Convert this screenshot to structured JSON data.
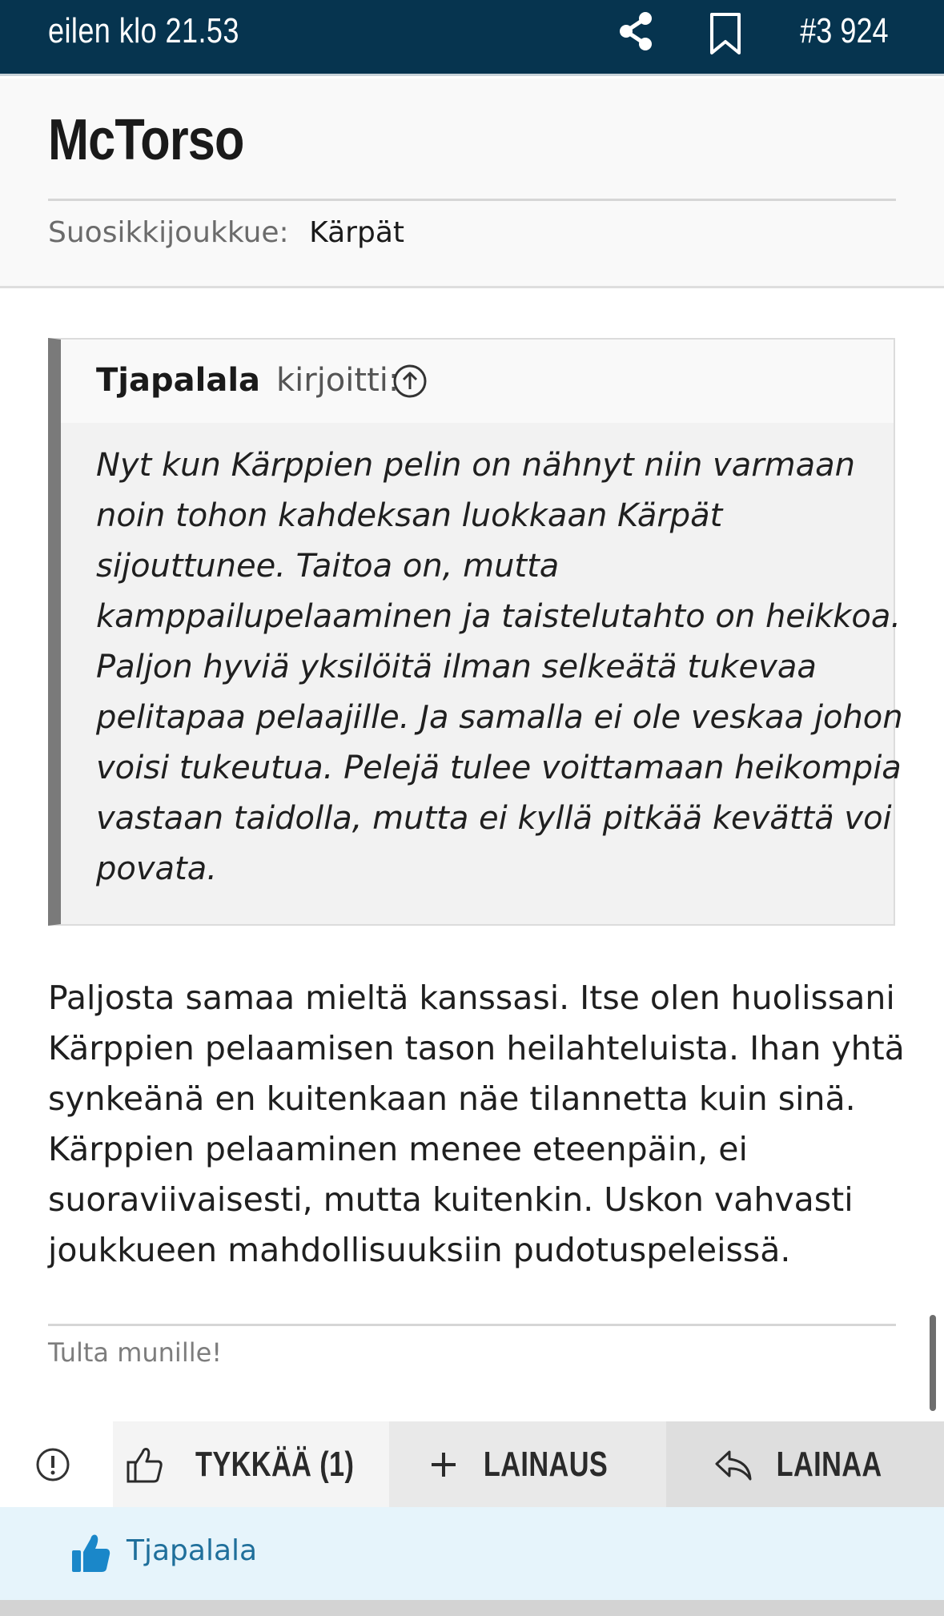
{
  "topbar": {
    "timestamp": "eilen klo 21.53",
    "share_icon": "share-icon",
    "bookmark_icon": "bookmark-icon",
    "post_number": "#3 924",
    "background_color": "#06344f"
  },
  "author": {
    "name": "McTorso",
    "team_label": "Suosikkijoukkue:",
    "team_value": "Kärpät"
  },
  "quote": {
    "author": "Tjapalala",
    "wrote": "kirjoitti:",
    "goto_icon": "arrow-up-circle-icon",
    "lines": [
      "Nyt kun Kärppien pelin on nähnyt niin varmaan",
      "noin tohon kahdeksan luokkaan Kärpät",
      "sijouttunee. Taitoa on, mutta",
      "kamppailupelaaminen ja taistelutahto on heikkoa.",
      "Paljon hyviä yksilöitä ilman selkeätä tukevaa",
      "pelitapaa pelaajille. Ja samalla ei ole veskaa johon",
      "voisi tukeutua. Pelejä tulee voittamaan heikompia",
      "vastaan taidolla, mutta ei kyllä pitkää kevättä voi",
      "povata."
    ]
  },
  "post": {
    "lines": [
      "Paljosta samaa mieltä kanssasi. Itse olen huolissani",
      "Kärppien pelaamisen tason heilahteluista. Ihan yhtä",
      "synkeänä en kuitenkaan näe tilannetta kuin sinä.",
      "Kärppien pelaaminen menee eteenpäin, ei",
      "suoraviivaisesti, mutta kuitenkin. Uskon vahvasti",
      "joukkueen mahdollisuuksiin pudotuspeleissä."
    ],
    "signature": "Tulta munille!"
  },
  "actions": {
    "report_icon": "exclamation-circle-icon",
    "like_label": "TYKKÄÄ (1)",
    "like_icon": "thumbs-up-outline-icon",
    "add_quote_label": "LAINAUS",
    "add_quote_icon": "plus-icon",
    "reply_label": "LAINAA",
    "reply_icon": "reply-arrow-icon"
  },
  "likers": {
    "icon": "thumbs-up-filled-icon",
    "names": [
      "Tjapalala"
    ],
    "accent_color": "#1f6f9b"
  }
}
